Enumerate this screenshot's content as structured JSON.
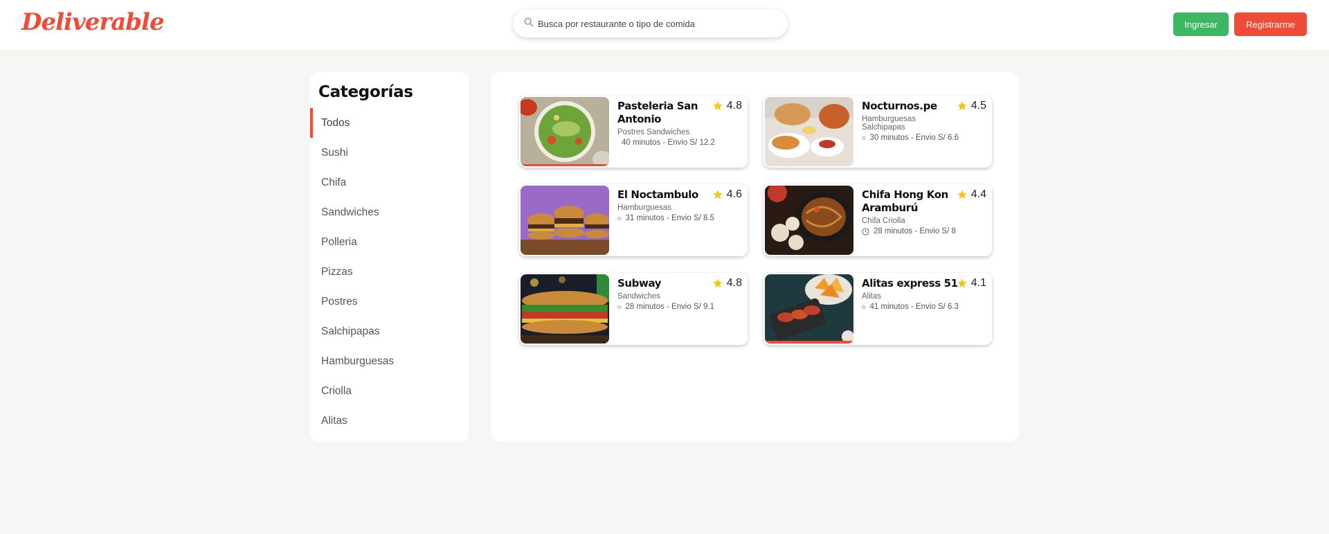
{
  "header": {
    "logo": "Deliverable",
    "search_placeholder": "Busca por restaurante o tipo de comida",
    "login_label": "Ingresar",
    "register_label": "Registrarme"
  },
  "sidebar": {
    "title": "Categorías",
    "items": [
      "Todos",
      "Sushi",
      "Chifa",
      "Sandwiches",
      "Polleria",
      "Pizzas",
      "Postres",
      "Salchipapas",
      "Hamburguesas",
      "Criolla",
      "Alitas"
    ],
    "active": "Todos"
  },
  "restaurants": [
    {
      "name": "Pasteleria San Antonio",
      "tags": "Postres Sandwiches",
      "meta": "40 minutos - Envio S/ 12.2",
      "rating": "4.8",
      "image": "salad-bowl"
    },
    {
      "name": "Nocturnos.pe",
      "tags": "Hamburguesas Salchipapas",
      "meta": "30 minutos - Envio S/ 6.6",
      "rating": "4.5",
      "image": "fried-chicken"
    },
    {
      "name": "El Noctambulo",
      "tags": "Hamburguesas",
      "meta": "31 minutos - Envio S/ 8.5",
      "rating": "4.6",
      "image": "burgers"
    },
    {
      "name": "Chifa Hong Kon Aramburú",
      "tags": "Chifa Criolla",
      "meta": "28 minutos - Envio S/ 8",
      "rating": "4.4",
      "image": "noodles-dumplings"
    },
    {
      "name": "Subway",
      "tags": "Sandwiches",
      "meta": "28 minutos - Envio S/ 9.1",
      "rating": "4.8",
      "image": "sub-sandwich"
    },
    {
      "name": "Alitas express 51",
      "tags": "Alitas",
      "meta": "41 minutos - Envio S/ 6.3",
      "rating": "4.1",
      "image": "wings-chips"
    }
  ],
  "colors": {
    "brand": "#ef4b36",
    "login": "#3cb862",
    "star": "#f5c518"
  },
  "icons": {
    "search": "search-icon",
    "clock": "clock-icon",
    "star": "star-icon"
  }
}
